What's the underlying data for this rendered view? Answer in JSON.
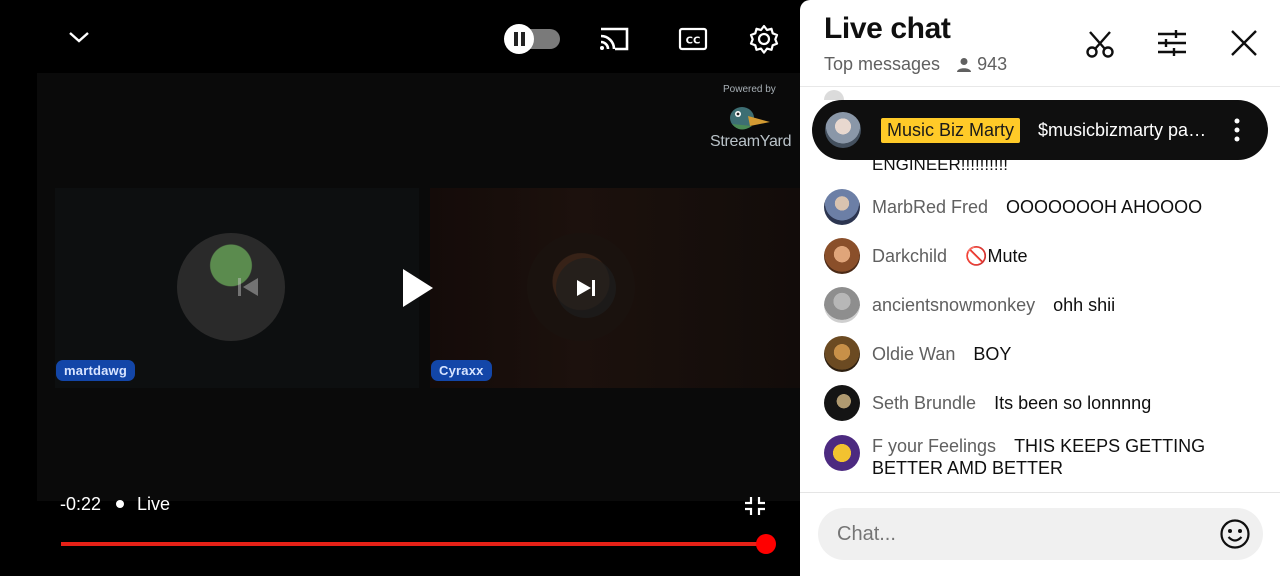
{
  "player": {
    "streamyard": {
      "powered_by": "Powered by",
      "name": "StreamYard"
    },
    "participants": [
      "martdawg",
      "Cyraxx"
    ],
    "time": "-0:22",
    "live_label": "Live",
    "progress_fraction": 1.0,
    "accent": "#ff0000"
  },
  "chat": {
    "title": "Live chat",
    "mode": "Top messages",
    "viewers": "943",
    "pinned": {
      "author": "Music Biz Marty",
      "text": "$musicbizmarty pa…",
      "highlight": "#ffca28"
    },
    "partial_line": "ENGINEER!!!!!!!!!!",
    "messages": [
      {
        "author": "MarbRed Fred",
        "text": "OOOOOOOH AHOOOO"
      },
      {
        "author": "Darkchild",
        "text": "🚫Mute"
      },
      {
        "author": "ancientsnowmonkey",
        "text": "ohh shii"
      },
      {
        "author": "Oldie Wan",
        "text": "BOY"
      },
      {
        "author": "Seth Brundle",
        "text": "Its been so lonnnng"
      },
      {
        "author": "F your Feelings",
        "text": "THIS KEEPS GETTING BETTER AMD BETTER"
      }
    ],
    "input_placeholder": "Chat..."
  },
  "icons": [
    "chevron-down-icon",
    "pause-icon",
    "cast-icon",
    "closed-captions-icon",
    "settings-icon",
    "previous-icon",
    "play-icon",
    "next-icon",
    "exit-fullscreen-icon",
    "person-icon",
    "scissors-icon",
    "tune-icon",
    "close-icon",
    "more-vert-icon",
    "emoji-icon"
  ]
}
